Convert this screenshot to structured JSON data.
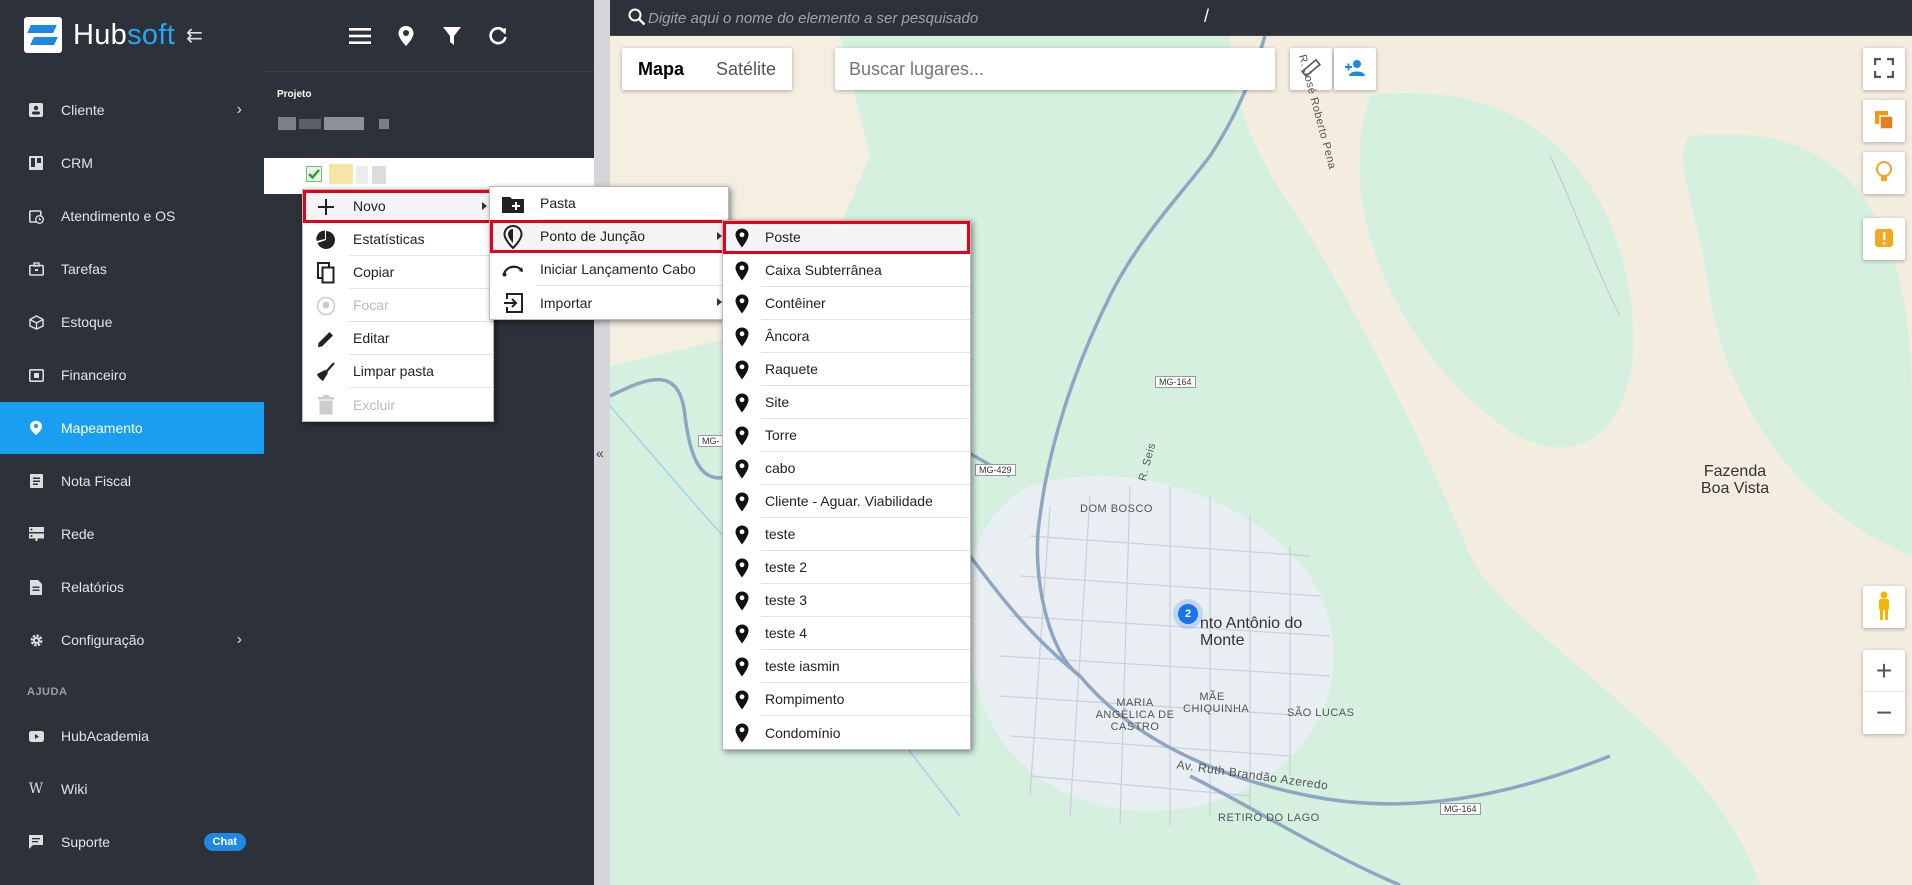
{
  "app": {
    "logo_text_main": "Hub",
    "logo_text_accent": "soft"
  },
  "sidebar": {
    "items": [
      {
        "label": "Cliente",
        "icon": "contact-card-icon",
        "has_submenu": true
      },
      {
        "label": "CRM",
        "icon": "kanban-icon",
        "has_submenu": false
      },
      {
        "label": "Atendimento e OS",
        "icon": "calendar-clock-icon",
        "has_submenu": false
      },
      {
        "label": "Tarefas",
        "icon": "briefcase-icon",
        "has_submenu": false
      },
      {
        "label": "Estoque",
        "icon": "box-icon",
        "has_submenu": false
      },
      {
        "label": "Financeiro",
        "icon": "money-icon",
        "has_submenu": false
      },
      {
        "label": "Mapeamento",
        "icon": "map-pin-person-icon",
        "has_submenu": false,
        "active": true
      },
      {
        "label": "Nota Fiscal",
        "icon": "receipt-icon",
        "has_submenu": false
      },
      {
        "label": "Rede",
        "icon": "server-icon",
        "has_submenu": false
      },
      {
        "label": "Relatórios",
        "icon": "document-icon",
        "has_submenu": false
      },
      {
        "label": "Configuração",
        "icon": "gear-icon",
        "has_submenu": true
      }
    ],
    "help_heading": "AJUDA",
    "help_items": [
      {
        "label": "HubAcademia",
        "icon": "youtube-icon"
      },
      {
        "label": "Wiki",
        "icon": "wiki-icon"
      },
      {
        "label": "Suporte",
        "icon": "chat-icon",
        "badge": "Chat"
      }
    ],
    "active_color": "#1a9ff0"
  },
  "tree_panel": {
    "project_label": "Projeto"
  },
  "map": {
    "search_placeholder": "Digite aqui o nome do elemento a ser pesquisado",
    "search_shortcut": "/",
    "map_types": [
      "Mapa",
      "Satélite"
    ],
    "selected_map_type": "Mapa",
    "places_placeholder": "Buscar lugares...",
    "labels": {
      "fazenda": "Fazenda Boa Vista",
      "town": "nto Antônio do Monte",
      "dom_bosco": "DOM BOSCO",
      "maria_angelica": "MARIA ANGÉLICA DE CASTRO",
      "mae_chiquinha": "MÃE CHIQUINHA",
      "sao_lucas": "SÃO LUCAS",
      "retiro": "RETIRO DO LAGO",
      "av_ruth": "Av. Ruth Brandão Azeredo",
      "r_seis": "R. Seis",
      "r_roberto": "R. José Roberto Pena",
      "mg164_a": "MG-164",
      "mg164_b": "MG-164",
      "mg429": "MG-429",
      "mg_left": "MG-"
    },
    "cluster_count": "2"
  },
  "context_menu": {
    "items": [
      {
        "label": "Novo",
        "icon": "plus-icon",
        "submenu": true,
        "highlighted": true
      },
      {
        "label": "Estatísticas",
        "icon": "pie-chart-icon"
      },
      {
        "label": "Copiar",
        "icon": "copy-icon"
      },
      {
        "label": "Focar",
        "icon": "focus-pin-icon",
        "disabled": true
      },
      {
        "label": "Editar",
        "icon": "pencil-icon"
      },
      {
        "label": "Limpar pasta",
        "icon": "broom-icon"
      },
      {
        "label": "Excluir",
        "icon": "trash-icon",
        "disabled": true
      }
    ]
  },
  "new_submenu": {
    "items": [
      {
        "label": "Pasta",
        "icon": "folder-plus-icon"
      },
      {
        "label": "Ponto de Junção",
        "icon": "junction-pin-icon",
        "submenu": true,
        "highlighted": true
      },
      {
        "label": "Iniciar Lançamento Cabo",
        "icon": "cable-arc-icon"
      },
      {
        "label": "Importar",
        "icon": "import-icon",
        "submenu": true
      }
    ]
  },
  "junction_submenu": {
    "items": [
      {
        "label": "Poste",
        "highlighted": true
      },
      {
        "label": "Caixa Subterrânea"
      },
      {
        "label": "Contêiner"
      },
      {
        "label": "Âncora"
      },
      {
        "label": "Raquete"
      },
      {
        "label": "Site"
      },
      {
        "label": "Torre"
      },
      {
        "label": "cabo"
      },
      {
        "label": "Cliente - Aguar. Viabilidade"
      },
      {
        "label": "teste"
      },
      {
        "label": "teste 2"
      },
      {
        "label": "teste 3"
      },
      {
        "label": "teste 4"
      },
      {
        "label": "teste iasmin"
      },
      {
        "label": "Rompimento"
      },
      {
        "label": "Condomínio"
      }
    ]
  },
  "colors": {
    "highlight_border": "#e3001b",
    "brand_blue": "#1a9ff0",
    "sidebar_bg": "#2d3139"
  }
}
